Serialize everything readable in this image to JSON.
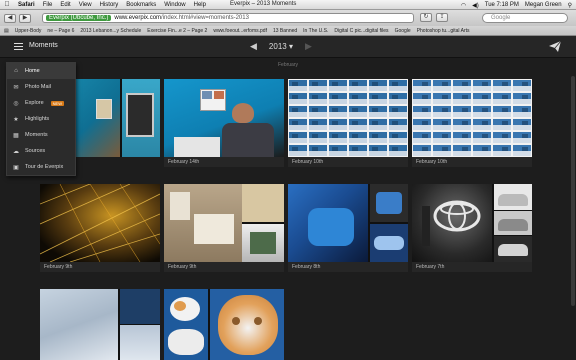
{
  "menubar": {
    "apple": "",
    "items": [
      "Safari",
      "File",
      "Edit",
      "View",
      "History",
      "Bookmarks",
      "Window",
      "Help"
    ],
    "window_title": "Everpix – 2013 Moments",
    "clock": "Tue 7:18 PM",
    "user": "Megan Green"
  },
  "browser": {
    "site_badge": "Everpix (Ubcube, Inc.)",
    "url_host": "www.everpix.com",
    "url_path": "/index.html#view=moments-2013",
    "search_placeholder": "Google",
    "bookmarks": [
      "Upper-Body",
      "ne – Page 6",
      "2013 Lebanon...y Schedule",
      "Exercise Fin...e 2 – Page 2",
      "www.foeout...erfoms.pdf",
      "13 Banned",
      "In The U.S.",
      "Digital C pic...digital files",
      "Google",
      "Photoshop tu...gital Arts"
    ]
  },
  "app": {
    "title": "Moments",
    "year": "2013",
    "year_caret": "▾",
    "prev_arrow": "◀",
    "next_arrow": "▶",
    "month_label": "February"
  },
  "nav": {
    "items": [
      {
        "label": "Home",
        "icon": "home-icon",
        "glyph": "⌂"
      },
      {
        "label": "Photo Mail",
        "icon": "mail-icon",
        "glyph": "✉"
      },
      {
        "label": "Explore",
        "icon": "explore-icon",
        "glyph": "◎",
        "badge": "NEW"
      },
      {
        "label": "Highlights",
        "icon": "star-icon",
        "glyph": "★"
      },
      {
        "label": "Moments",
        "icon": "moments-icon",
        "glyph": "▦"
      },
      {
        "label": "Sources",
        "icon": "cloud-icon",
        "glyph": "☁"
      },
      {
        "label": "Tour de Everpix",
        "icon": "tour-icon",
        "glyph": "▣"
      }
    ]
  },
  "moments": [
    {
      "caption": ""
    },
    {
      "caption": "February 14th"
    },
    {
      "caption": "February 10th"
    },
    {
      "caption": "February 10th"
    },
    {
      "caption": "February 9th"
    },
    {
      "caption": "February 9th"
    },
    {
      "caption": "February 8th"
    },
    {
      "caption": "February 7th"
    },
    {
      "caption": ""
    },
    {
      "caption": ""
    }
  ],
  "colors": {
    "accent_badge": "#d87a17",
    "app_bg": "#1d1d1d",
    "caption_bg": "#262626"
  }
}
